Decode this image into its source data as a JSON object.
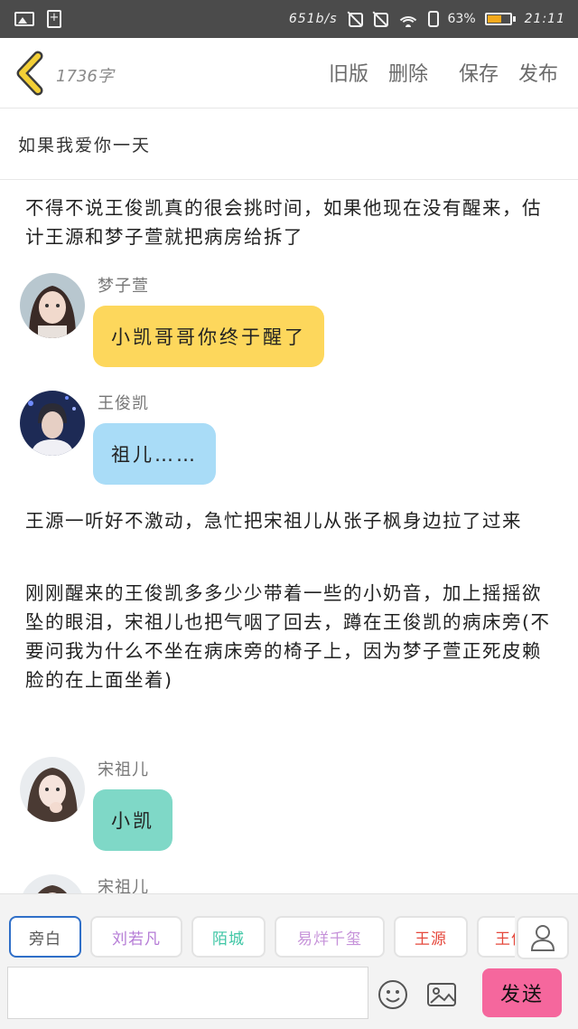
{
  "status_bar": {
    "speed": "651b/s",
    "battery_percent": "63%",
    "battery_level": 0.63,
    "battery_color": "#f4a91c",
    "time": "21:11",
    "icons": [
      "gallery-icon",
      "sim-add-icon",
      "mute-icon",
      "vibrate-off-icon",
      "wifi-icon",
      "phone-icon",
      "battery-icon"
    ]
  },
  "toolbar": {
    "word_count": "1736字",
    "old_version": "旧版",
    "delete": "删除",
    "save": "保存",
    "publish": "发布",
    "back_color": "#f3cf36"
  },
  "story": {
    "title": "如果我爱你一天",
    "paragraph_1": "不得不说王俊凯真的很会挑时间，如果他现在没有醒来，估计王源和梦子萱就把病房给拆了",
    "paragraph_2": "王源一听好不激动，急忙把宋祖儿从张子枫身边拉了过来",
    "paragraph_3": "刚刚醒来的王俊凯多多少少带着一些的小奶音，加上摇摇欲坠的眼泪，宋祖儿也把气咽了回去，蹲在王俊凯的病床旁(不要问我为什么不坐在病床旁的椅子上，因为梦子萱正死皮赖脸的在上面坐着)"
  },
  "messages": [
    {
      "speaker": "梦子萱",
      "text": "小凯哥哥你终于醒了",
      "bubble_color": "#fdd75c"
    },
    {
      "speaker": "王俊凯",
      "text": "祖儿……",
      "bubble_color": "#a9dcf7"
    },
    {
      "speaker": "宋祖儿",
      "text": "小凯",
      "bubble_color": "#7fd8c7"
    },
    {
      "speaker": "宋祖儿",
      "text": ""
    }
  ],
  "characters": [
    {
      "label": "旁白",
      "color": "#555555"
    },
    {
      "label": "刘若凡",
      "color": "#b57bd6"
    },
    {
      "label": "陌城",
      "color": "#3fc6a5"
    },
    {
      "label": "易烊千玺",
      "color": "#c692d9"
    },
    {
      "label": "王源",
      "color": "#e5483c"
    },
    {
      "label": "王俊凯",
      "color": "#e5483c"
    }
  ],
  "composer": {
    "input_value": "",
    "send": "发送",
    "send_color": "#f5679d"
  }
}
